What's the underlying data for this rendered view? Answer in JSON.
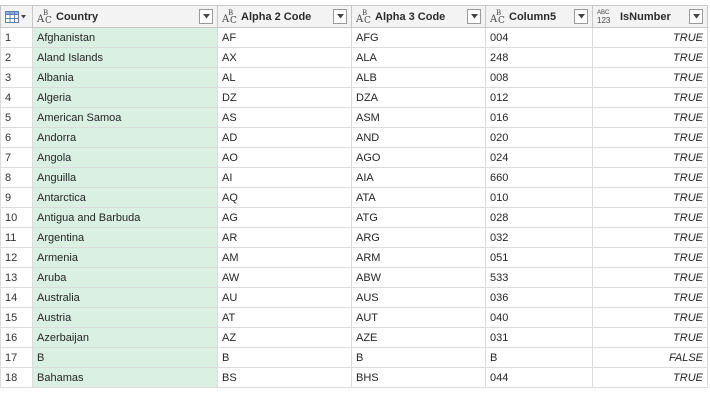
{
  "columns": [
    {
      "label": "Country",
      "type": "text"
    },
    {
      "label": "Alpha 2 Code",
      "type": "text"
    },
    {
      "label": "Alpha 3 Code",
      "type": "text"
    },
    {
      "label": "Column5",
      "type": "text"
    },
    {
      "label": "IsNumber",
      "type": "any"
    }
  ],
  "type_icons": {
    "text": {
      "a": "A",
      "b": "B",
      "c": "C"
    },
    "any": {
      "t1": "ABC",
      "t2": "123"
    }
  },
  "rows": [
    {
      "idx": "1",
      "country": "Afghanistan",
      "a2": "AF",
      "a3": "AFG",
      "col5": "004",
      "isnum": "TRUE"
    },
    {
      "idx": "2",
      "country": "Aland Islands",
      "a2": "AX",
      "a3": "ALA",
      "col5": "248",
      "isnum": "TRUE"
    },
    {
      "idx": "3",
      "country": "Albania",
      "a2": "AL",
      "a3": "ALB",
      "col5": "008",
      "isnum": "TRUE"
    },
    {
      "idx": "4",
      "country": "Algeria",
      "a2": "DZ",
      "a3": "DZA",
      "col5": "012",
      "isnum": "TRUE"
    },
    {
      "idx": "5",
      "country": "American Samoa",
      "a2": "AS",
      "a3": "ASM",
      "col5": "016",
      "isnum": "TRUE"
    },
    {
      "idx": "6",
      "country": "Andorra",
      "a2": "AD",
      "a3": "AND",
      "col5": "020",
      "isnum": "TRUE"
    },
    {
      "idx": "7",
      "country": "Angola",
      "a2": "AO",
      "a3": "AGO",
      "col5": "024",
      "isnum": "TRUE"
    },
    {
      "idx": "8",
      "country": "Anguilla",
      "a2": "AI",
      "a3": "AIA",
      "col5": "660",
      "isnum": "TRUE"
    },
    {
      "idx": "9",
      "country": "Antarctica",
      "a2": "AQ",
      "a3": "ATA",
      "col5": "010",
      "isnum": "TRUE"
    },
    {
      "idx": "10",
      "country": "Antigua and Barbuda",
      "a2": "AG",
      "a3": "ATG",
      "col5": "028",
      "isnum": "TRUE"
    },
    {
      "idx": "11",
      "country": "Argentina",
      "a2": "AR",
      "a3": "ARG",
      "col5": "032",
      "isnum": "TRUE"
    },
    {
      "idx": "12",
      "country": "Armenia",
      "a2": "AM",
      "a3": "ARM",
      "col5": "051",
      "isnum": "TRUE"
    },
    {
      "idx": "13",
      "country": "Aruba",
      "a2": "AW",
      "a3": "ABW",
      "col5": "533",
      "isnum": "TRUE"
    },
    {
      "idx": "14",
      "country": "Australia",
      "a2": "AU",
      "a3": "AUS",
      "col5": "036",
      "isnum": "TRUE"
    },
    {
      "idx": "15",
      "country": "Austria",
      "a2": "AT",
      "a3": "AUT",
      "col5": "040",
      "isnum": "TRUE"
    },
    {
      "idx": "16",
      "country": "Azerbaijan",
      "a2": "AZ",
      "a3": "AZE",
      "col5": "031",
      "isnum": "TRUE"
    },
    {
      "idx": "17",
      "country": "B",
      "a2": "B",
      "a3": "B",
      "col5": "B",
      "isnum": "FALSE"
    },
    {
      "idx": "18",
      "country": "Bahamas",
      "a2": "BS",
      "a3": "BHS",
      "col5": "044",
      "isnum": "TRUE"
    }
  ]
}
